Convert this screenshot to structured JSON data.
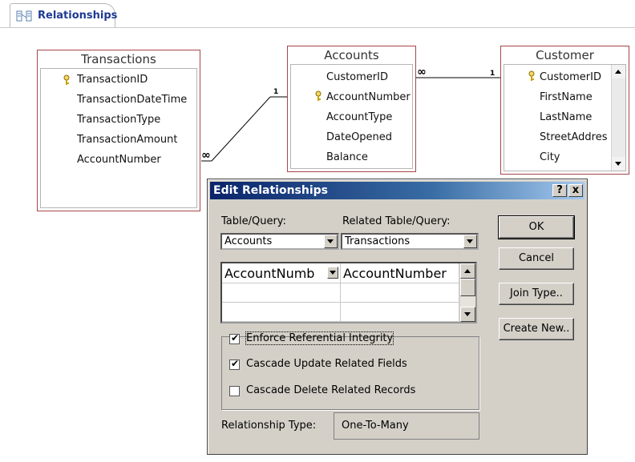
{
  "tab": {
    "label": "Relationships",
    "icon": "relationships-icon"
  },
  "tables": {
    "transactions": {
      "title": "Transactions",
      "fields": [
        "TransactionID",
        "TransactionDateTime",
        "TransactionType",
        "TransactionAmount",
        "AccountNumber"
      ],
      "primary_key": "TransactionID"
    },
    "accounts": {
      "title": "Accounts",
      "fields": [
        "CustomerID",
        "AccountNumber",
        "AccountType",
        "DateOpened",
        "Balance"
      ],
      "primary_key": "AccountNumber"
    },
    "customer": {
      "title": "Customer",
      "fields": [
        "CustomerID",
        "FirstName",
        "LastName",
        "StreetAddres",
        "City"
      ],
      "primary_key": "CustomerID"
    }
  },
  "relationships": [
    {
      "from": "Accounts",
      "to": "Transactions",
      "one_label": "1",
      "many_label": "∞"
    },
    {
      "from": "Customer",
      "to": "Accounts",
      "one_label": "1",
      "many_label": "∞"
    }
  ],
  "dialog": {
    "title": "Edit Relationships",
    "help_button": "?",
    "close_button": "x",
    "table_query_label": "Table/Query:",
    "related_table_query_label": "Related Table/Query:",
    "table_query_value": "Accounts",
    "related_table_query_value": "Transactions",
    "grid": {
      "rows": [
        [
          "AccountNumb",
          "AccountNumber"
        ],
        [
          "",
          ""
        ],
        [
          "",
          ""
        ]
      ]
    },
    "buttons": {
      "ok": "OK",
      "cancel": "Cancel",
      "join_type": "Join Type..",
      "create_new": "Create New.."
    },
    "checkboxes": {
      "enforce": {
        "label": "Enforce Referential Integrity",
        "checked": true
      },
      "cascade_update": {
        "label": "Cascade Update Related Fields",
        "checked": true
      },
      "cascade_delete": {
        "label": "Cascade Delete Related Records",
        "checked": false
      }
    },
    "relationship_type_label": "Relationship Type:",
    "relationship_type_value": "One-To-Many"
  }
}
